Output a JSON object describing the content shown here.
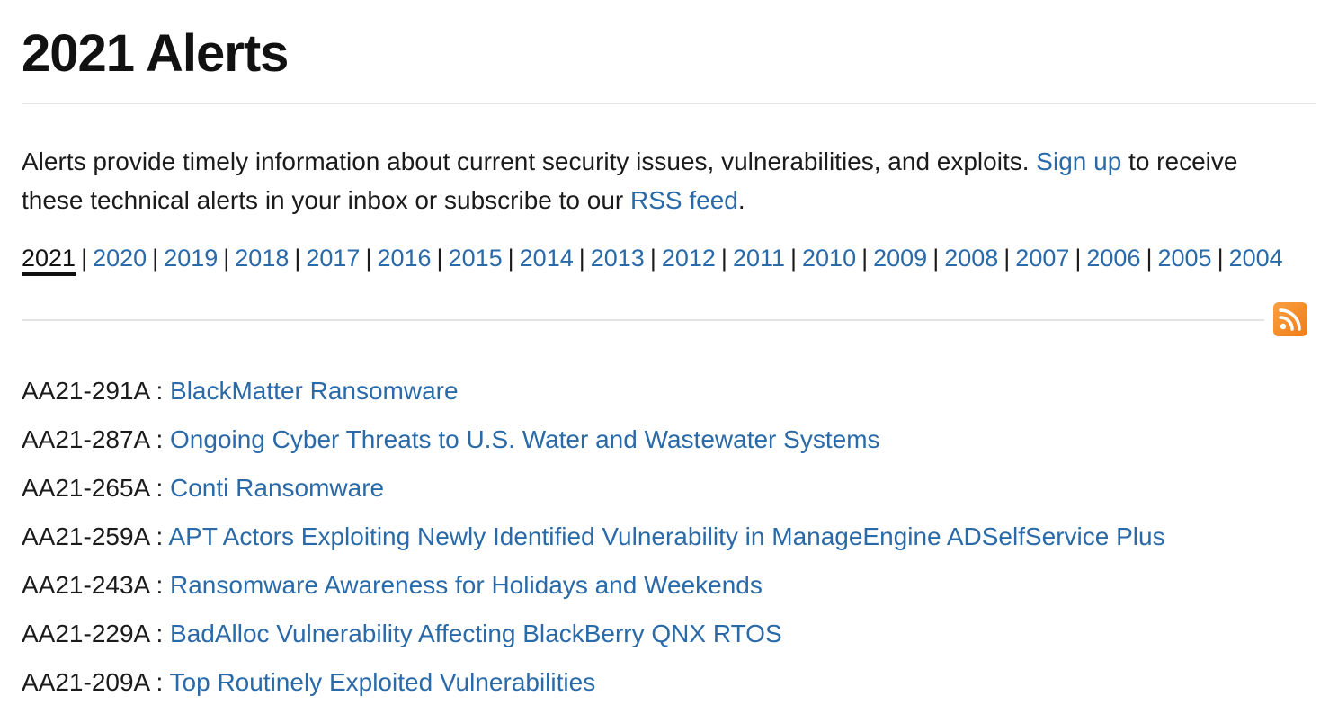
{
  "page_title": "2021 Alerts",
  "intro": {
    "text_before": "Alerts provide timely information about current security issues, vulnerabilities, and exploits. ",
    "signup_link": "Sign up",
    "text_middle": " to receive these technical alerts in your inbox or subscribe to our ",
    "rss_link": "RSS feed",
    "text_after": "."
  },
  "years": {
    "current": "2021",
    "links": [
      "2020",
      "2019",
      "2018",
      "2017",
      "2016",
      "2015",
      "2014",
      "2013",
      "2012",
      "2011",
      "2010",
      "2009",
      "2008",
      "2007",
      "2006",
      "2005",
      "2004"
    ],
    "separator": "|"
  },
  "rss_icon": "rss-feed-icon",
  "alerts": [
    {
      "code": "AA21-291A",
      "title": "BlackMatter Ransomware"
    },
    {
      "code": "AA21-287A",
      "title": "Ongoing Cyber Threats to U.S. Water and Wastewater Systems"
    },
    {
      "code": "AA21-265A",
      "title": "Conti Ransomware"
    },
    {
      "code": "AA21-259A",
      "title": "APT Actors Exploiting Newly Identified Vulnerability in ManageEngine ADSelfService Plus"
    },
    {
      "code": "AA21-243A",
      "title": "Ransomware Awareness for Holidays and Weekends"
    },
    {
      "code": "AA21-229A",
      "title": "BadAlloc Vulnerability Affecting BlackBerry QNX RTOS"
    },
    {
      "code": "AA21-209A",
      "title": "Top Routinely Exploited Vulnerabilities"
    }
  ],
  "colors": {
    "link": "#2a6aa8",
    "text": "#1b1b1b",
    "rule": "#e4e4e4",
    "rss_orange": "#f07d15"
  }
}
